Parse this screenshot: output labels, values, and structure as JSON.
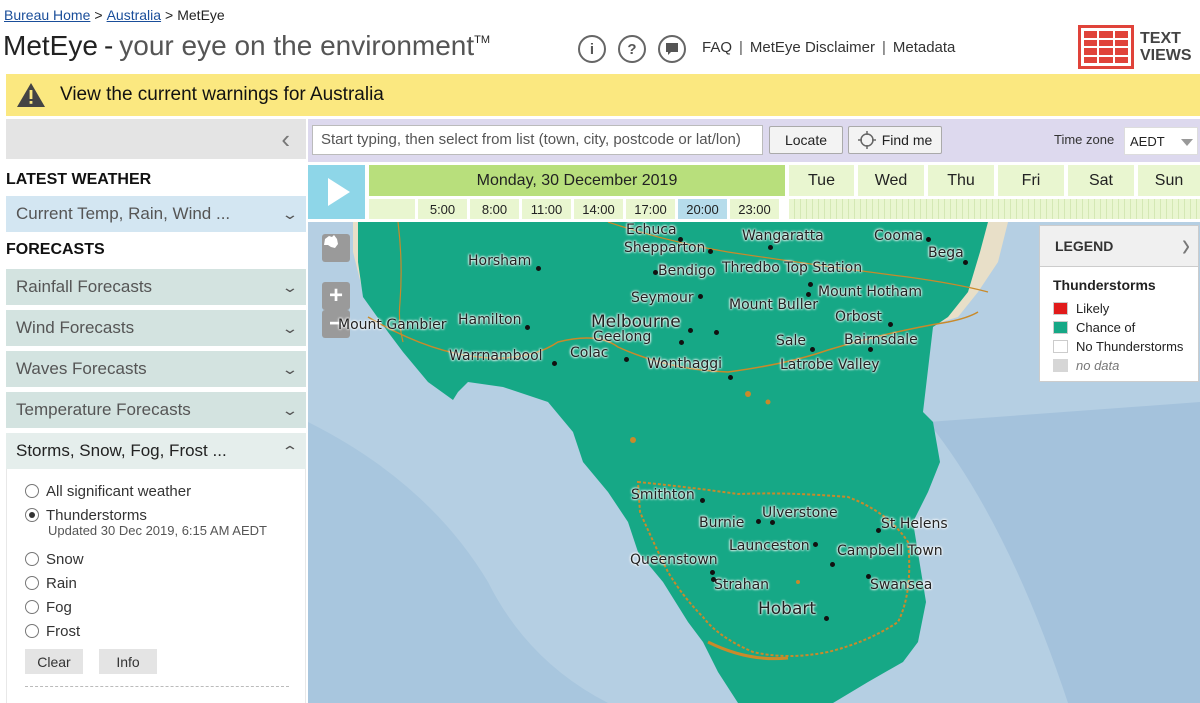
{
  "breadcrumb": {
    "home": "Bureau Home",
    "sep1": ">",
    "australia": "Australia",
    "sep2": ">",
    "current": "MetEye"
  },
  "header": {
    "brand": "MetEye",
    "dash": "-",
    "tagline": "your eye on the environment",
    "tm": "TM",
    "info_icon_glyph": "i",
    "help_icon_glyph": "?",
    "links": [
      "FAQ",
      "MetEye Disclaimer",
      "Metadata"
    ],
    "link_sep": "|",
    "text_views": [
      "TEXT",
      "VIEWS"
    ]
  },
  "warning_bar": {
    "text": "View the current warnings for Australia"
  },
  "sidebar": {
    "collapse_glyph": "‹",
    "latest_heading": "LATEST WEATHER",
    "current_item": "Current Temp, Rain, Wind ...",
    "forecasts_heading": "FORECASTS",
    "forecast_items": [
      "Rainfall Forecasts",
      "Wind Forecasts",
      "Waves Forecasts",
      "Temperature Forecasts"
    ],
    "open_item": "Storms, Snow, Fog, Frost ...",
    "options": [
      {
        "label": "All significant weather",
        "checked": false
      },
      {
        "label": "Thunderstorms",
        "checked": true
      },
      {
        "label": "Snow",
        "checked": false
      },
      {
        "label": "Rain",
        "checked": false
      },
      {
        "label": "Fog",
        "checked": false
      },
      {
        "label": "Frost",
        "checked": false
      }
    ],
    "updated": "Updated 30 Dec 2019, 6:15 AM AEDT",
    "clear_label": "Clear",
    "info_label": "Info"
  },
  "search": {
    "placeholder": "Start typing, then select from list (town, city, postcode or lat/lon)",
    "locate_label": "Locate",
    "findme_label": "Find me",
    "tz_label": "Time zone",
    "tz_value": "AEDT"
  },
  "timeline": {
    "active_day": "Monday, 30 December 2019",
    "days": [
      "Tue",
      "Wed",
      "Thu",
      "Fri",
      "Sat",
      "Sun"
    ],
    "hours": [
      "5:00",
      "8:00",
      "11:00",
      "14:00",
      "17:00",
      "20:00",
      "23:00"
    ],
    "current_hour": "20:00"
  },
  "map": {
    "zoom_in": "+",
    "zoom_out": "−",
    "places": {
      "echuca": "Echuca",
      "shepparton": "Shepparton",
      "wangaratta": "Wangaratta",
      "cooma": "Cooma",
      "bega": "Bega",
      "horsham": "Horsham",
      "bendigo": "Bendigo",
      "thredbo": "Thredbo Top Station",
      "seymour": "Seymour",
      "mount_hotham": "Mount Hotham",
      "mount_buller": "Mount Buller",
      "mount_gambier": "Mount Gambier",
      "hamilton": "Hamilton",
      "melbourne": "Melbourne",
      "orbost": "Orbost",
      "geelong": "Geelong",
      "sale": "Sale",
      "bairnsdale": "Bairnsdale",
      "warrnambool": "Warrnambool",
      "colac": "Colac",
      "wonthaggi": "Wonthaggi",
      "latrobe": "Latrobe Valley",
      "smithton": "Smithton",
      "ulverstone": "Ulverstone",
      "burnie": "Burnie",
      "st_helens": "St Helens",
      "launceston": "Launceston",
      "campbell_town": "Campbell Town",
      "queenstown": "Queenstown",
      "strahan": "Strahan",
      "swansea": "Swansea",
      "hobart": "Hobart"
    }
  },
  "legend": {
    "header": "LEGEND",
    "title": "Thunderstorms",
    "items": [
      {
        "label": "Likely",
        "color": "#e11b1b"
      },
      {
        "label": "Chance of",
        "color": "#16a886"
      },
      {
        "label": "No Thunderstorms",
        "color": "#ffffff"
      },
      {
        "label": "no data",
        "color": "#d6d6d6"
      }
    ]
  },
  "colors": {
    "storm_chance": "#16a886",
    "ocean": "#b5cfe3",
    "land": "#e8dfc8",
    "warning_bar": "#fbe880",
    "active_day": "#b8df7c",
    "current_hour": "#b6dceb"
  }
}
